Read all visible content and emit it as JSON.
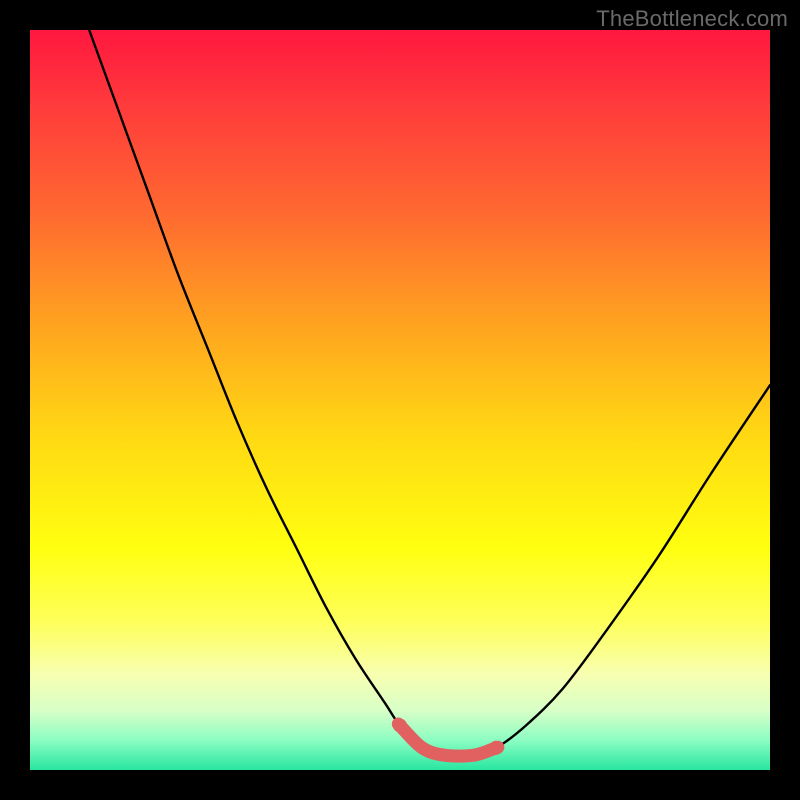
{
  "watermark": "TheBottleneck.com",
  "colors": {
    "curve_stroke": "#000000",
    "marker_stroke": "#e16060",
    "marker_fill": "#e16060"
  },
  "chart_data": {
    "type": "line",
    "title": "",
    "xlabel": "",
    "ylabel": "",
    "xlim": [
      0,
      100
    ],
    "ylim": [
      0,
      100
    ],
    "grid": false,
    "legend": false,
    "series": [
      {
        "name": "bottleneck-curve",
        "x": [
          8,
          12,
          16,
          20,
          24,
          28,
          32,
          36,
          40,
          44,
          48,
          50,
          53,
          56,
          60,
          63,
          67,
          72,
          78,
          85,
          92,
          100
        ],
        "y": [
          100,
          89,
          78,
          67,
          57,
          47,
          38,
          30,
          22,
          15,
          9,
          6,
          3,
          2,
          2,
          3,
          6,
          11,
          19,
          29,
          40,
          52
        ]
      }
    ],
    "annotations": [
      {
        "name": "valley-highlight",
        "type": "marker-band",
        "x_range": [
          50,
          63
        ],
        "y_approx": 2.5
      }
    ]
  }
}
